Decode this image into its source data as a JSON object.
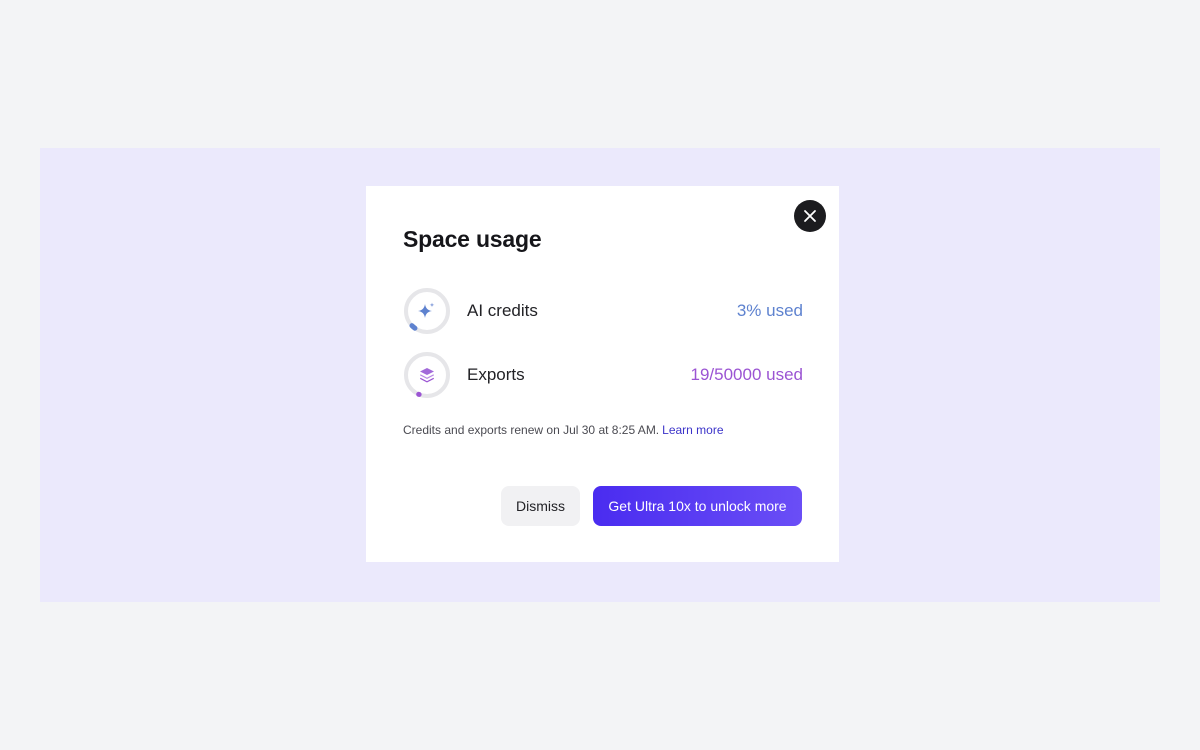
{
  "dialog": {
    "title": "Space usage",
    "close_icon": "close-icon"
  },
  "usage": [
    {
      "label": "AI credits",
      "value": "3% used",
      "icon": "sparkle-icon",
      "fraction": 0.03,
      "color": "#5e82cf"
    },
    {
      "label": "Exports",
      "value": "19/50000 used",
      "icon": "layers-icon",
      "fraction": 0.0004,
      "color": "#9b54d3"
    }
  ],
  "footnote": {
    "text": "Credits and exports renew on Jul 30 at 8:25 AM.",
    "link": "Learn more"
  },
  "actions": {
    "dismiss_label": "Dismiss",
    "upgrade_label": "Get Ultra 10x to unlock more"
  },
  "colors": {
    "backdrop": "#ebe9fc",
    "primary": "#4a2cf0",
    "link": "#3b33c9"
  }
}
